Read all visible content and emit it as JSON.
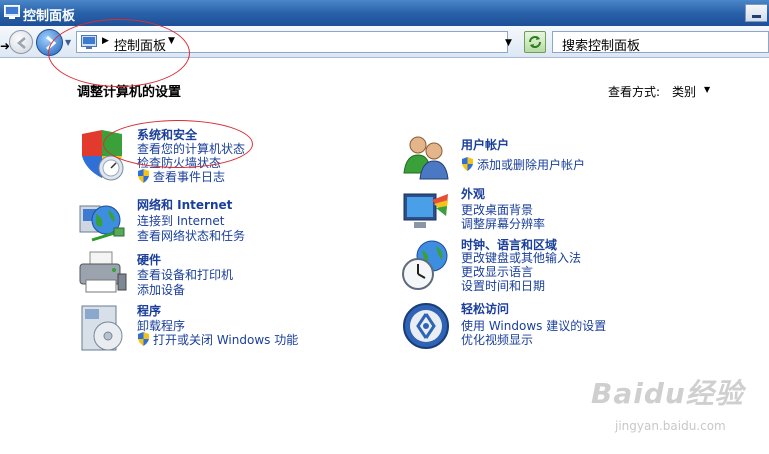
{
  "window": {
    "title": "控制面板",
    "minimize": "minimize"
  },
  "address": {
    "breadcrumb": "控制面板",
    "search_placeholder": "搜索控制面板"
  },
  "content": {
    "heading": "调整计算机的设置",
    "view_by_label": "查看方式:",
    "view_by_value": "类别"
  },
  "categories": [
    {
      "title": "系统和安全",
      "links": [
        "查看您的计算机状态",
        "检查防火墙状态"
      ],
      "shield_links": [
        "查看事件日志"
      ],
      "icon": "security-shield-icon"
    },
    {
      "title": "网络和 Internet",
      "links": [
        "连接到 Internet",
        "查看网络状态和任务"
      ],
      "shield_links": [],
      "icon": "network-globe-icon"
    },
    {
      "title": "硬件",
      "links": [
        "查看设备和打印机",
        "添加设备"
      ],
      "shield_links": [],
      "icon": "printer-icon"
    },
    {
      "title": "程序",
      "links": [
        "卸载程序"
      ],
      "shield_links": [
        "打开或关闭 Windows 功能"
      ],
      "icon": "programs-disc-icon"
    },
    {
      "title": "用户帐户",
      "links": [],
      "shield_links": [
        "添加或删除用户帐户"
      ],
      "icon": "users-icon"
    },
    {
      "title": "外观",
      "links": [
        "更改桌面背景",
        "调整屏幕分辨率"
      ],
      "shield_links": [],
      "icon": "appearance-monitor-icon"
    },
    {
      "title": "时钟、语言和区域",
      "links": [
        "更改键盘或其他输入法",
        "更改显示语言",
        "设置时间和日期"
      ],
      "shield_links": [],
      "icon": "clock-globe-icon"
    },
    {
      "title": "轻松访问",
      "links": [
        "使用 Windows 建议的设置",
        "优化视频显示"
      ],
      "shield_links": [],
      "icon": "ease-of-access-icon"
    }
  ],
  "watermark": {
    "brand": "Baidu经验",
    "url": "jingyan.baidu.com"
  },
  "colors": {
    "link": "#1a3f9a",
    "titlebar": "#2a62aa",
    "annotation": "#d82d34"
  }
}
